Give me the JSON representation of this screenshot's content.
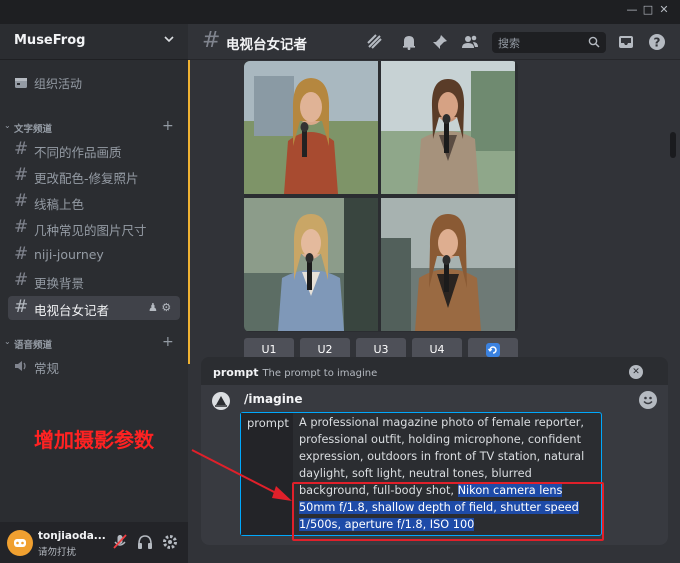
{
  "window": {
    "minimize": "—",
    "maximize": "□",
    "close": "✕"
  },
  "server": {
    "name": "MuseFrog"
  },
  "sidebar": {
    "event_label": "组织活动",
    "categories": [
      {
        "label": "文字频道"
      },
      {
        "label": "语音频道"
      }
    ],
    "text_channels": [
      {
        "label": "不同的作品画质"
      },
      {
        "label": "更改配色-修复照片"
      },
      {
        "label": "线稿上色"
      },
      {
        "label": "几种常见的图片尺寸"
      },
      {
        "label": "niji-journey"
      },
      {
        "label": "更换背景"
      },
      {
        "label": "电视台女记者"
      }
    ],
    "voice_channels": [
      {
        "label": "常规"
      }
    ]
  },
  "user": {
    "name": "tonjiaoda...",
    "status": "请勿打扰"
  },
  "channel": {
    "title": "电视台女记者"
  },
  "search": {
    "placeholder": "搜索"
  },
  "upscale_buttons": [
    "U1",
    "U2",
    "U3",
    "U4"
  ],
  "command": {
    "header_name": "prompt",
    "header_desc": "The prompt to imagine",
    "name": "/imagine",
    "param_label": "prompt",
    "text_plain": "A professional magazine photo of female reporter, professional outfit, holding microphone, confident expression, outdoors in front of TV station, natural daylight, soft light, neutral tones, blurred background, full-body shot, ",
    "text_highlight": "Nikon camera lens 50mm f/1.8, shallow depth of field, shutter speed 1/500s, aperture f/1.8, ISO 100"
  },
  "annotation": {
    "text": "增加摄影参数",
    "color": "#ff2222"
  },
  "colors": {
    "accent": "#f0b232",
    "highlight": "#1e4ba8",
    "input_border": "#00a8fc"
  }
}
